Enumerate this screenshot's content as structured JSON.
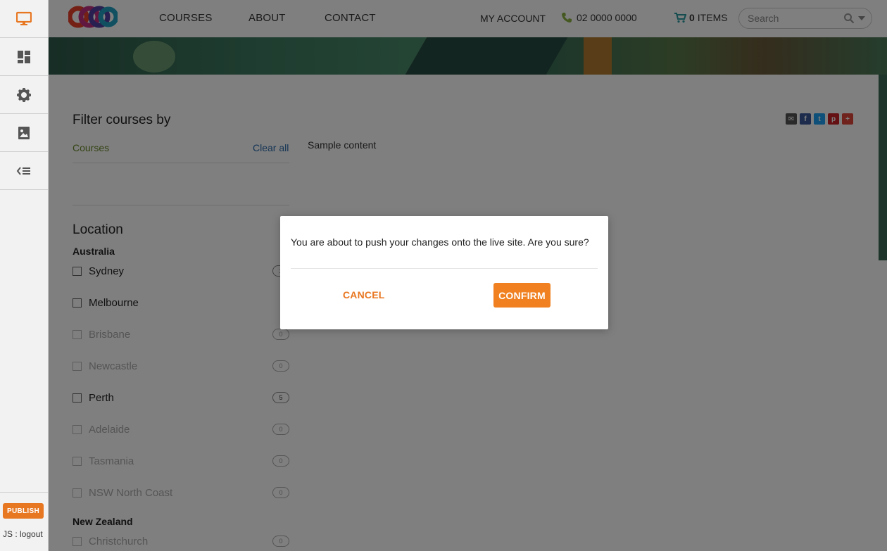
{
  "admin_sidebar": {
    "items": [
      {
        "icon": "monitor-icon"
      },
      {
        "icon": "dashboard-icon"
      },
      {
        "icon": "gear-icon"
      },
      {
        "icon": "image-icon"
      },
      {
        "icon": "list-icon"
      }
    ],
    "publish_label": "PUBLISH",
    "logout_label": "JS : logout",
    "accent": "#e87722"
  },
  "header": {
    "nav": [
      "COURSES",
      "ABOUT",
      "CONTACT"
    ],
    "account": "MY ACCOUNT",
    "phone": "02 0000 0000",
    "cart_count": "0",
    "cart_label": "ITEMS",
    "search_placeholder": "Search"
  },
  "filter": {
    "title": "Filter courses by",
    "courses_label": "Courses",
    "clear_all": "Clear all",
    "location_title": "Location"
  },
  "main": {
    "sample": "Sample content"
  },
  "locations": {
    "australia_label": "Australia",
    "australia": [
      {
        "name": "Sydney",
        "count": "1",
        "disabled": false
      },
      {
        "name": "Melbourne",
        "count": "",
        "disabled": false
      },
      {
        "name": "Brisbane",
        "count": "0",
        "disabled": true
      },
      {
        "name": "Newcastle",
        "count": "0",
        "disabled": true
      },
      {
        "name": "Perth",
        "count": "5",
        "disabled": false
      },
      {
        "name": "Adelaide",
        "count": "0",
        "disabled": true
      },
      {
        "name": "Tasmania",
        "count": "0",
        "disabled": true
      },
      {
        "name": "NSW North Coast",
        "count": "0",
        "disabled": true
      }
    ],
    "nz_label": "New Zealand",
    "nz": [
      {
        "name": "Christchurch",
        "count": "0",
        "disabled": true
      }
    ]
  },
  "modal": {
    "message": "You are about to push your changes onto the live site. Are you sure?",
    "cancel": "CANCEL",
    "confirm": "CONFIRM"
  }
}
